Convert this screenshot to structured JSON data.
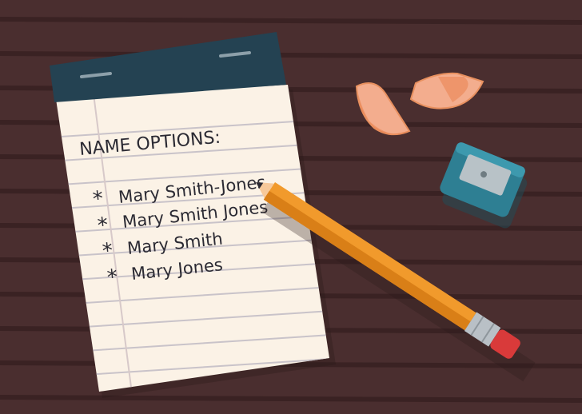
{
  "notepad": {
    "heading": "NAME OPTIONS:",
    "bullet": "*",
    "items": [
      "Mary Smith-Jones",
      "Mary Smith Jones",
      "Mary Smith",
      "Mary Jones"
    ]
  },
  "colors": {
    "table_plank": "#4a2e2f",
    "table_groove": "#3a2223",
    "paper": "#fbf2e6",
    "paper_line": "#c9c3c9",
    "margin_line": "#d7c9c9",
    "pad_binding": "#244252",
    "pencil_body": "#f19a2c",
    "pencil_wood": "#f7c99a",
    "eraser": "#d93a3a",
    "sharpener": "#2e7f93",
    "shaving": "#f3ad8e",
    "ink": "#2b2a33"
  },
  "icons": [
    "notepad-icon",
    "pencil-icon",
    "sharpener-icon",
    "pencil-shaving-icon"
  ]
}
